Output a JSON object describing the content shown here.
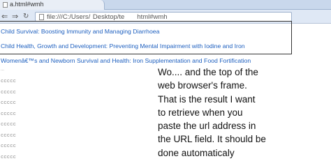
{
  "browser": {
    "tab_title": "a.html#wmh",
    "url": "file:///C:/Users/          Desktop/test/a.html#wmh"
  },
  "links": [
    "Child Survival: Boosting Immunity and Managing Diarrhoea",
    "Child Health, Growth and Development: Preventing Mental Impairment with Iodine and Iron",
    "Womenâ€™s and Newborn Survival and Health: Iron Supplementation and Food Fortification"
  ],
  "ellipsis_text": "...",
  "c_rows": [
    "ccccc",
    "ccccc",
    "ccccc",
    "ccccc",
    "ccccc",
    "ccccc",
    "ccccc",
    "ccccc"
  ],
  "note_lines": [
    "Wo.... and the top of the",
    "web browser's frame.",
    "That is the result I want",
    "to retrieve when you",
    "paste the url address in",
    "the URL field. It should be",
    "done automaticaly"
  ]
}
